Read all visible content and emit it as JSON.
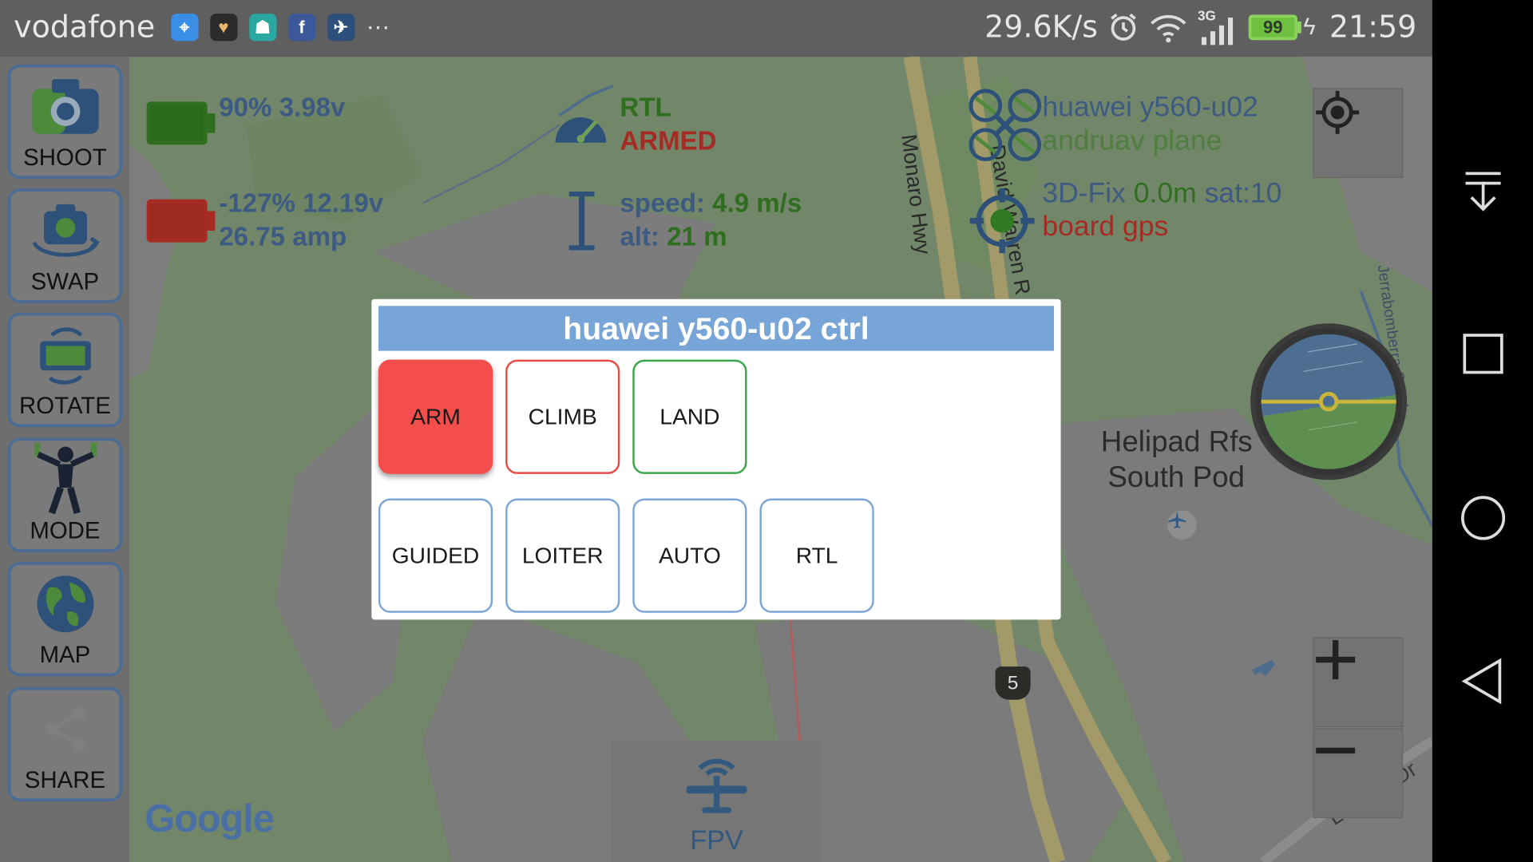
{
  "statusbar": {
    "carrier": "vodafone",
    "more": "⋯",
    "net_speed": "29.6K/s",
    "net_type": "3G",
    "battery": "99",
    "clock": "21:59"
  },
  "toolbar": {
    "shoot": "SHOOT",
    "swap": "SWAP",
    "rotate": "ROTATE",
    "mode": "MODE",
    "map": "MAP",
    "share": "SHARE"
  },
  "telemetry": {
    "battery1": "90% 3.98v",
    "battery2_line1": "-127% 12.19v",
    "battery2_line2": "26.75 amp",
    "flight_mode": "RTL",
    "armed_state": "ARMED",
    "speed_label": "speed:",
    "speed_value": "4.9 m/s",
    "alt_label": "alt:",
    "alt_value": "21 m",
    "vehicle_name": "huawei y560-u02",
    "vehicle_type": "andruav plane",
    "gps_fix": "3D-Fix",
    "gps_precision": "0.0m",
    "gps_sat": "sat:10",
    "gps_source": "board gps"
  },
  "map": {
    "road1": "Monaro Hwy",
    "road2": "David Warren R",
    "road3": "Jerrabomberra Creek",
    "road4": "Lanyon Dr",
    "place_line1": "Helipad Rfs",
    "place_line2": "South Pod",
    "route_shield": "5",
    "attribution": "Google",
    "fpv_label": "FPV"
  },
  "dialog": {
    "title": "huawei y560-u02 ctrl",
    "arm": "ARM",
    "climb": "CLIMB",
    "land": "LAND",
    "guided": "GUIDED",
    "loiter": "LOITER",
    "auto": "AUTO",
    "rtl": "RTL"
  },
  "colors": {
    "arm": "#f44e4c",
    "climb_border": "#ea4a45",
    "land_border": "#3aa84a",
    "mode_border": "#7ba7d6",
    "title_bar": "#78a5d7"
  }
}
